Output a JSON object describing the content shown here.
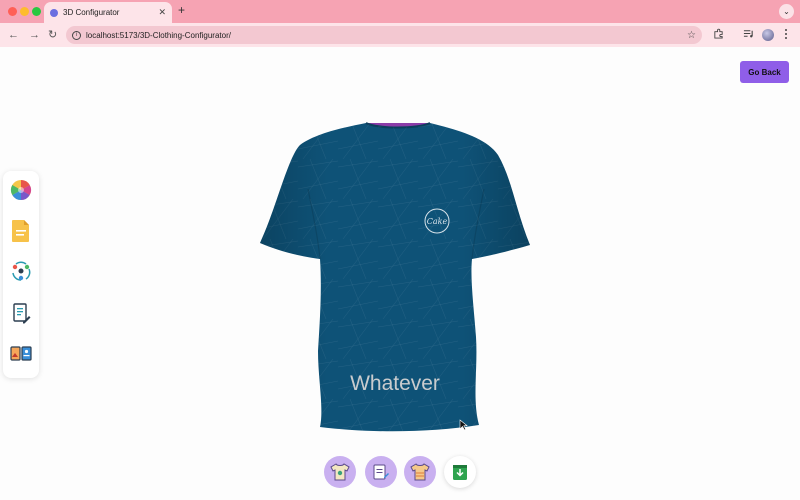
{
  "browser": {
    "tab_title": "3D Configurator",
    "tab_close": "✕",
    "new_tab": "+",
    "tabs_menu": "⌄",
    "back": "←",
    "forward": "→",
    "reload": "↻",
    "url": "localhost:5173/3D-Clothing-Configurator/",
    "star": "☆",
    "colors": {
      "tabbar": "#f6a3b3",
      "toolbar": "#fde4e9"
    }
  },
  "header": {
    "go_back_label": "Go Back"
  },
  "sidebar": {
    "items": [
      {
        "icon": "color-wheel-icon",
        "tool": "color-picker"
      },
      {
        "icon": "document-icon",
        "tool": "file-picker"
      },
      {
        "icon": "ai-recycle-icon",
        "tool": "ai-picker"
      },
      {
        "icon": "text-edit-icon",
        "tool": "text-editor"
      },
      {
        "icon": "image-gallery-icon",
        "tool": "image-picker"
      }
    ]
  },
  "shirt": {
    "color": "#0e5277",
    "logo_text": "Cake",
    "print_text": "Whatever"
  },
  "bottom_tabs": [
    {
      "icon": "shirt-logo-icon"
    },
    {
      "icon": "shirt-text-icon"
    },
    {
      "icon": "shirt-pattern-icon"
    },
    {
      "icon": "download-icon"
    }
  ],
  "colors": {
    "accent": "#8f5ee8",
    "tab_bg": "#c9b0f0"
  }
}
